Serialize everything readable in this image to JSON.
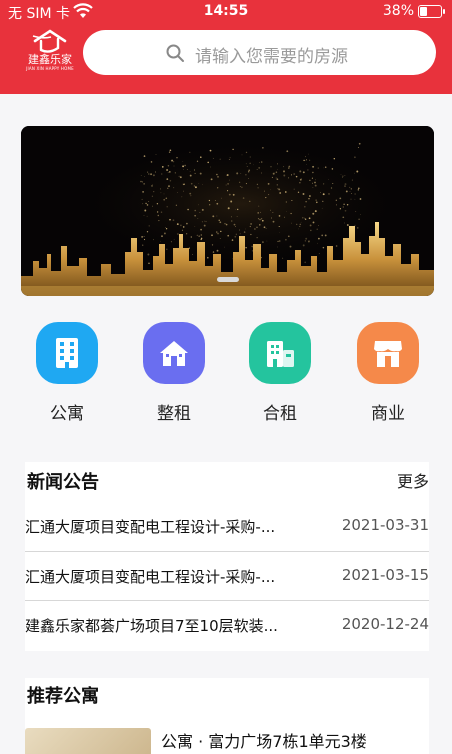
{
  "status_bar": {
    "carrier": "无 SIM 卡",
    "time": "14:55",
    "battery": "38%",
    "battery_level": 0.38
  },
  "header": {
    "logo_text": "建鑫乐家",
    "logo_subtext": "JIAN XIN HAPPY HOME",
    "search_placeholder": "请输入您需要的房源"
  },
  "categories": [
    {
      "label": "公寓",
      "icon": "apartment-building-icon",
      "color": "#1fa8f2"
    },
    {
      "label": "整租",
      "icon": "house-icon",
      "color": "#6a6ef0"
    },
    {
      "label": "合租",
      "icon": "shared-building-icon",
      "color": "#24c49e"
    },
    {
      "label": "商业",
      "icon": "shop-icon",
      "color": "#f5894a"
    }
  ],
  "news": {
    "title": "新闻公告",
    "more": "更多",
    "items": [
      {
        "title": "汇通大厦项目变配电工程设计-采购-...",
        "date": "2021-03-31"
      },
      {
        "title": "汇通大厦项目变配电工程设计-采购-...",
        "date": "2021-03-15"
      },
      {
        "title": "建鑫乐家都荟广场项目7至10层软装...",
        "date": "2020-12-24"
      }
    ]
  },
  "recommend": {
    "title": "推荐公寓",
    "first_item_title": "公寓 · 富力广场7栋1单元3楼"
  },
  "colors": {
    "brand_red": "#e8323c",
    "page_bg": "#f6f6f8"
  }
}
